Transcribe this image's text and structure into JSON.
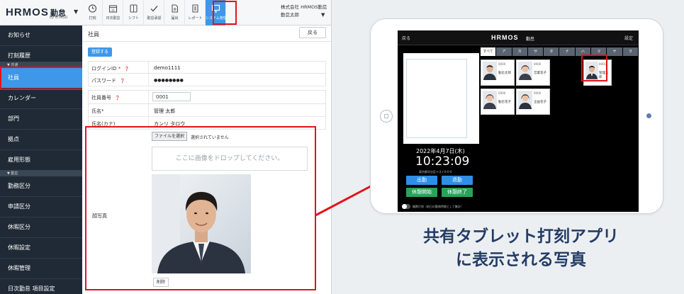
{
  "admin": {
    "logo": {
      "brand": "HRMOS",
      "brand_suffix": "勤怠",
      "byline": "by IEYASU"
    },
    "nav": [
      {
        "label": "打刻",
        "icon": "clock-icon"
      },
      {
        "label": "日次勤怠",
        "icon": "calendar-icon"
      },
      {
        "label": "シフト",
        "icon": "shift-icon"
      },
      {
        "label": "勤怠承認",
        "icon": "check-icon"
      },
      {
        "label": "届出",
        "icon": "document-icon"
      },
      {
        "label": "レポート",
        "icon": "report-icon"
      },
      {
        "label": "システム管理",
        "icon": "monitor-icon",
        "active": true
      }
    ],
    "company": {
      "name": "株式会社 HRMOS勤怠",
      "user": "勤怠太郎"
    },
    "sidebar": {
      "items": [
        "お知らせ",
        "打刻履歴",
        "社員",
        "カレンダー",
        "部門",
        "拠点",
        "雇用形態",
        "勤務区分",
        "申請区分",
        "休暇区分",
        "休暇設定",
        "休暇管理",
        "日次勤怠 項目設定"
      ],
      "sections": [
        "▼ 共通",
        "▼ 勤怠"
      ]
    },
    "main": {
      "title": "社員",
      "back_label": "戻る",
      "register_label": "登録する",
      "login_id_label": "ログインID",
      "login_id_required": "*",
      "login_id_value": "demo1111",
      "password_label": "パスワード",
      "password_value": "●●●●●●●●",
      "empno_label": "社員番号",
      "empno_value": "0001",
      "name_label": "氏名*",
      "name_value": "管理 太郎",
      "kana_label": "氏名(カナ)",
      "kana_value": "カンリ タロウ",
      "photo_label": "顔写真",
      "file_button": "ファイルを選択",
      "file_status": "選択されていません",
      "dropzone_text": "ここに画像をドロップしてください。",
      "delete_label": "削除"
    }
  },
  "tablet": {
    "back": "戻る",
    "logo": "HRMOS",
    "logo_suffix": "勤怠",
    "settings": "設定",
    "tabs": [
      "すべて",
      "ア",
      "カ",
      "サ",
      "タ",
      "ナ",
      "ハ",
      "マ",
      "ヤ",
      "ラ",
      "ワ"
    ],
    "cards": [
      {
        "id": "0000",
        "name": "勤怠太郎"
      },
      {
        "id": "0000",
        "name": "営業花子"
      },
      {
        "id": "0001",
        "name": "管理太郎"
      },
      {
        "id": "0000",
        "name": "勤怠花子"
      },
      {
        "id": "0000",
        "name": "企画花子"
      }
    ],
    "date": "2022年4月7日(木)",
    "time": "10:23:09",
    "address": "東京都渋谷区テスト0-0-0",
    "buttons": {
      "clock_in": "出勤",
      "clock_out": "退勤",
      "break_start": "休憩開始",
      "break_end": "休憩終了"
    },
    "note": "複数打刻（前日の勤務時間として集計）"
  },
  "caption": {
    "line1": "共有タブレット打刻アプリ",
    "line2": "に表示される写真"
  },
  "colors": {
    "highlight": "#e3131b",
    "accent": "#3e97e8",
    "sidebar": "#1f2a36",
    "caption": "#243c66"
  }
}
